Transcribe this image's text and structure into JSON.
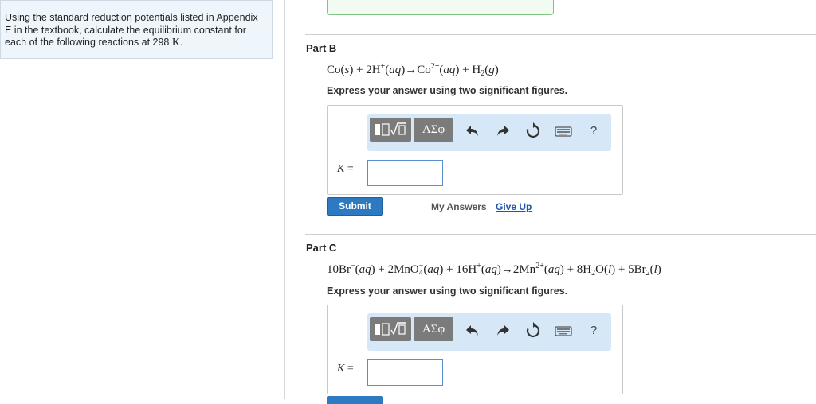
{
  "intro": {
    "text": "Using the standard reduction potentials listed in Appendix E in the textbook, calculate the equilibrium constant for each of the following reactions at 298",
    "unit": "K",
    "period": "."
  },
  "parts": [
    {
      "title": "Part B",
      "instruction": "Express your answer using two significant figures.",
      "k_label": "K",
      "k_equals": " =",
      "input_value": "",
      "toolbar": {
        "greek_label": "ΑΣφ",
        "help_label": "?"
      }
    },
    {
      "title": "Part C",
      "instruction": "Express your answer using two significant figures.",
      "k_label": "K",
      "k_equals": " =",
      "input_value": "",
      "toolbar": {
        "greek_label": "ΑΣφ",
        "help_label": "?"
      }
    }
  ],
  "actions": {
    "submit_label": "Submit",
    "my_answers_label": "My Answers",
    "give_up_label": "Give Up"
  },
  "colors": {
    "accent": "#2d7ac2",
    "toolbar_bg": "#d6e8f8",
    "intro_bg": "#eef5fb",
    "correct_border": "#7fc47f",
    "link": "#1f55b0"
  },
  "icons": [
    "template-icon",
    "greek-symbols-icon",
    "undo-icon",
    "redo-icon",
    "reset-icon",
    "keyboard-icon",
    "help-icon"
  ]
}
